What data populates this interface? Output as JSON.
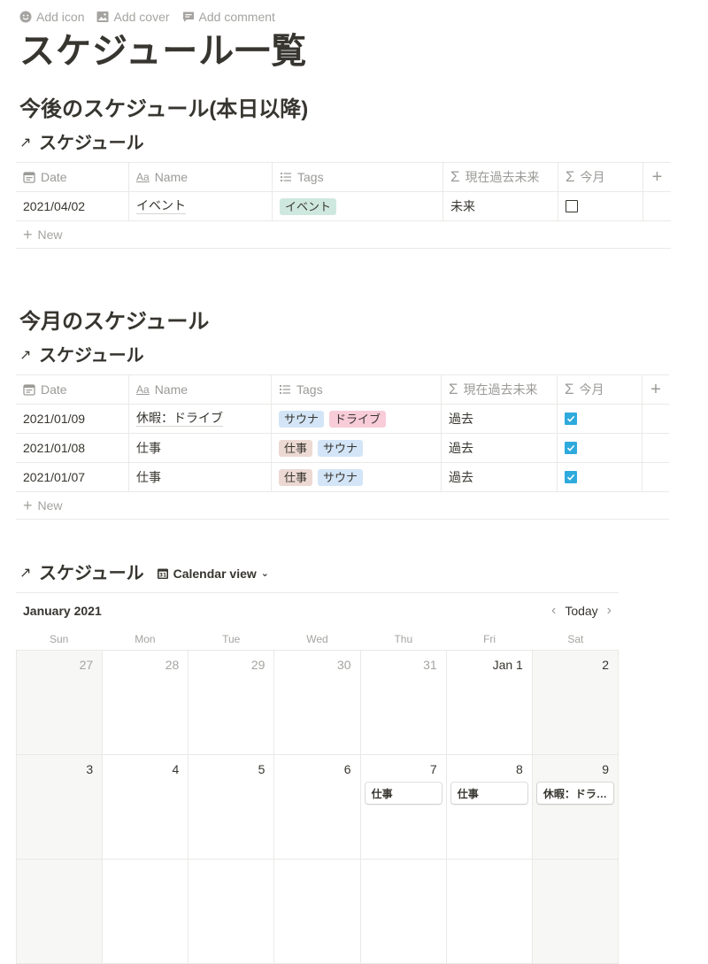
{
  "top_actions": {
    "add_icon": "Add icon",
    "add_cover": "Add cover",
    "add_comment": "Add comment"
  },
  "page_title": "スケジュール一覧",
  "section1": {
    "heading": "今後のスケジュール(本日以降)",
    "db_title": "スケジュール",
    "columns": {
      "date": "Date",
      "name": "Name",
      "tags": "Tags",
      "status": "現在過去未来",
      "this_month": "今月"
    },
    "rows": [
      {
        "date": "2021/04/02",
        "name": "イベント",
        "tags": [
          "イベント"
        ],
        "status": "未来",
        "this_month": false
      }
    ],
    "new_label": "New"
  },
  "section2": {
    "heading": "今月のスケジュール",
    "db_title": "スケジュール",
    "columns": {
      "date": "Date",
      "name": "Name",
      "tags": "Tags",
      "status": "現在過去未来",
      "this_month": "今月"
    },
    "rows": [
      {
        "date": "2021/01/09",
        "name": "休暇：ドライブ",
        "tags": [
          "サウナ",
          "ドライブ"
        ],
        "status": "過去",
        "this_month": true
      },
      {
        "date": "2021/01/08",
        "name": "仕事",
        "tags": [
          "仕事",
          "サウナ"
        ],
        "status": "過去",
        "this_month": true
      },
      {
        "date": "2021/01/07",
        "name": "仕事",
        "tags": [
          "仕事",
          "サウナ"
        ],
        "status": "過去",
        "this_month": true
      }
    ],
    "new_label": "New"
  },
  "calendar": {
    "db_title": "スケジュール",
    "view_label": "Calendar view",
    "month": "January 2021",
    "today_label": "Today",
    "weekdays": [
      "Sun",
      "Mon",
      "Tue",
      "Wed",
      "Thu",
      "Fri",
      "Sat"
    ],
    "week1": [
      "27",
      "28",
      "29",
      "30",
      "31",
      "Jan 1",
      "2"
    ],
    "week2": [
      "3",
      "4",
      "5",
      "6",
      "7",
      "8",
      "9"
    ],
    "events": {
      "thu7": "仕事",
      "fri8": "仕事",
      "sat9": "休暇：ドラ…"
    }
  },
  "colors": {
    "accent": "#2eaadc",
    "tag_event": "#cfe8df",
    "tag_sauna": "#d3e5f7",
    "tag_drive": "#f8ccd9",
    "tag_work": "#ecd9d3"
  }
}
